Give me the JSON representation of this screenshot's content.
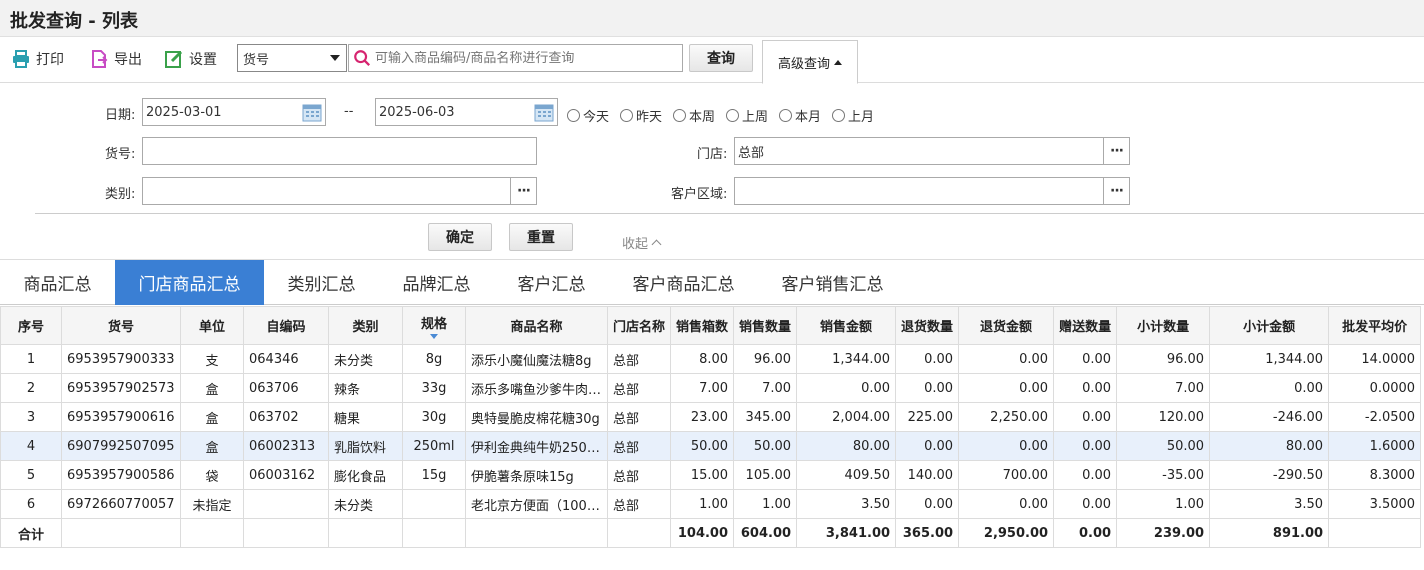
{
  "title": "批发查询 - 列表",
  "toolbar": {
    "print": "打印",
    "export": "导出",
    "settings": "设置",
    "field_select": "货号",
    "search_placeholder": "可输入商品编码/商品名称进行查询",
    "query": "查询",
    "advanced": "高级查询"
  },
  "filters": {
    "date_label": "日期:",
    "date_from": "2025-03-01",
    "date_sep": "--",
    "date_to": "2025-06-03",
    "radios": [
      "今天",
      "昨天",
      "本周",
      "上周",
      "本月",
      "上月"
    ],
    "code_label": "货号:",
    "code_value": "",
    "store_label": "门店:",
    "store_value": "总部",
    "category_label": "类别:",
    "category_value": "",
    "region_label": "客户区域:",
    "region_value": "",
    "ok": "确定",
    "reset": "重置",
    "collapse": "收起"
  },
  "tabs": [
    "商品汇总",
    "门店商品汇总",
    "类别汇总",
    "品牌汇总",
    "客户汇总",
    "客户商品汇总",
    "客户销售汇总"
  ],
  "active_tab": 1,
  "table": {
    "headers": [
      "序号",
      "货号",
      "单位",
      "自编码",
      "类别",
      "规格",
      "商品名称",
      "门店名称",
      "销售箱数",
      "销售数量",
      "销售金额",
      "退货数量",
      "退货金额",
      "赠送数量",
      "小计数量",
      "小计金额",
      "批发平均价"
    ],
    "rows": [
      [
        "1",
        "6953957900333",
        "支",
        "064346",
        "未分类",
        "8g",
        "添乐小魔仙魔法糖8g",
        "总部",
        "8.00",
        "96.00",
        "1,344.00",
        "0.00",
        "0.00",
        "0.00",
        "96.00",
        "1,344.00",
        "14.0000"
      ],
      [
        "2",
        "6953957902573",
        "盒",
        "063706",
        "辣条",
        "33g",
        "添乐多嘴鱼沙爹牛肉…",
        "总部",
        "7.00",
        "7.00",
        "0.00",
        "0.00",
        "0.00",
        "0.00",
        "7.00",
        "0.00",
        "0.0000"
      ],
      [
        "3",
        "6953957900616",
        "盒",
        "063702",
        "糖果",
        "30g",
        "奥特曼脆皮棉花糖30g",
        "总部",
        "23.00",
        "345.00",
        "2,004.00",
        "225.00",
        "2,250.00",
        "0.00",
        "120.00",
        "-246.00",
        "-2.0500"
      ],
      [
        "4",
        "6907992507095",
        "盒",
        "06002313",
        "乳脂饮料",
        "250ml",
        "伊利金典纯牛奶250…",
        "总部",
        "50.00",
        "50.00",
        "80.00",
        "0.00",
        "0.00",
        "0.00",
        "50.00",
        "80.00",
        "1.6000"
      ],
      [
        "5",
        "6953957900586",
        "袋",
        "06003162",
        "膨化食品",
        "15g",
        "伊脆薯条原味15g",
        "总部",
        "15.00",
        "105.00",
        "409.50",
        "140.00",
        "700.00",
        "0.00",
        "-35.00",
        "-290.50",
        "8.3000"
      ],
      [
        "6",
        "6972660770057",
        "未指定",
        "",
        "未分类",
        "",
        "老北京方便面（100…",
        "总部",
        "1.00",
        "1.00",
        "3.50",
        "0.00",
        "0.00",
        "0.00",
        "1.00",
        "3.50",
        "3.5000"
      ]
    ],
    "totals": [
      "合计",
      "",
      "",
      "",
      "",
      "",
      "",
      "",
      "104.00",
      "604.00",
      "3,841.00",
      "365.00",
      "2,950.00",
      "0.00",
      "239.00",
      "891.00",
      ""
    ]
  },
  "colors": {
    "accent": "#3a7fd4",
    "highlight_row": "#e8f0fb"
  }
}
